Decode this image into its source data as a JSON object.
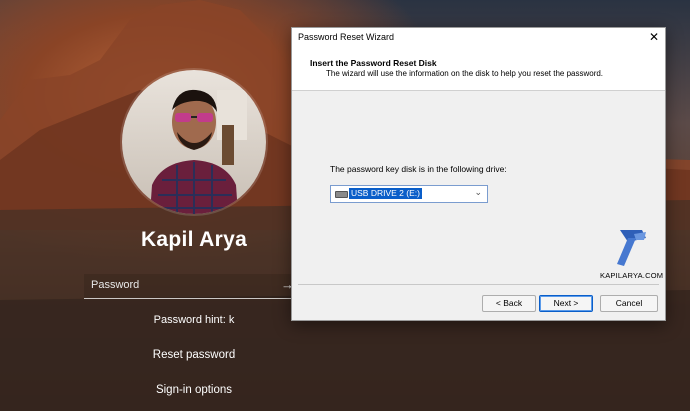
{
  "login": {
    "username": "Kapil Arya",
    "password_placeholder": "Password",
    "password_hint": "Password hint: k",
    "reset_password": "Reset password",
    "signin_options": "Sign-in options"
  },
  "wizard": {
    "title": "Password Reset Wizard",
    "close_glyph": "✕",
    "heading": "Insert the Password Reset Disk",
    "subheading": "The wizard will use the information on the disk to help you reset the password.",
    "drive_prompt": "The password key disk is in the following drive:",
    "selected_drive": "USB DRIVE 2 (E:)",
    "logo_text": "KAPILARYA.COM",
    "buttons": {
      "back": "< Back",
      "next": "Next >",
      "cancel": "Cancel"
    }
  },
  "icons": {
    "submit": "arrow-right-icon",
    "drive": "usb-drive-icon",
    "dropdown": "chevron-down-icon",
    "logo": "hammer-logo-icon"
  },
  "colors": {
    "selection": "#0a5ec9",
    "logo_blue": "#3d6fc5",
    "dialog_bg": "#f0f0f0"
  }
}
